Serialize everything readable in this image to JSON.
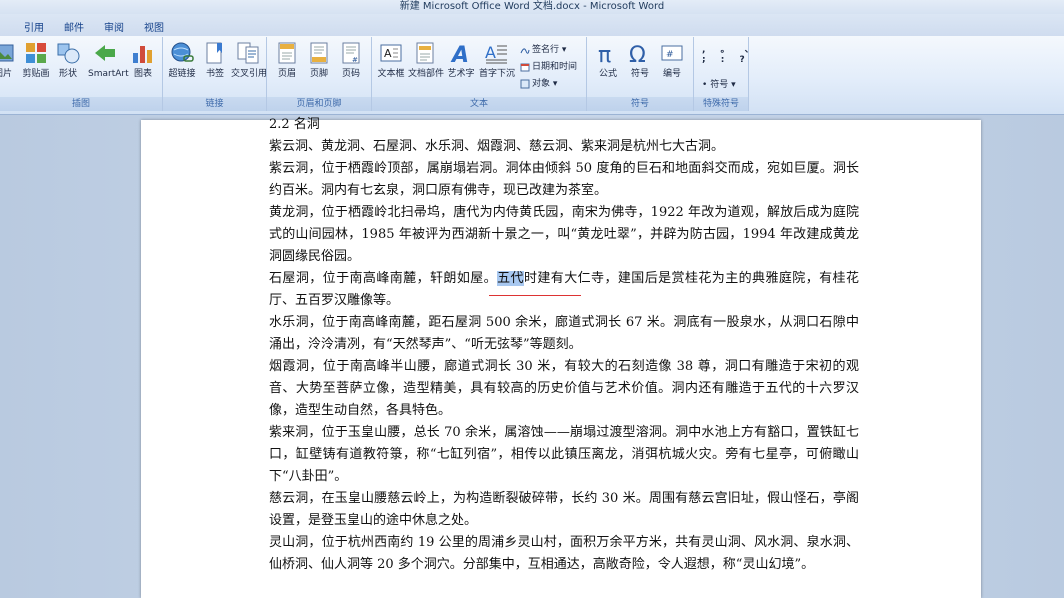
{
  "window": {
    "title": "新建 Microsoft Office Word 文档.docx - Microsoft Word"
  },
  "tabs": [
    {
      "label": "引用"
    },
    {
      "label": "邮件"
    },
    {
      "label": "审阅"
    },
    {
      "label": "视图"
    }
  ],
  "ribbon": {
    "groups": [
      {
        "label": "插图",
        "buttons": [
          "图片",
          "剪贴画",
          "形状",
          "SmartArt",
          "图表"
        ]
      },
      {
        "label": "链接",
        "buttons": [
          "超链接",
          "书签",
          "交叉引用"
        ]
      },
      {
        "label": "页眉和页脚",
        "buttons": [
          "页眉",
          "页脚",
          "页码"
        ]
      },
      {
        "label": "文本",
        "buttons": [
          "文本框",
          "文档部件",
          "艺术字",
          "首字下沉"
        ],
        "small": [
          "签名行",
          "日期和时间",
          "对象"
        ]
      },
      {
        "label": "符号",
        "buttons": [
          "公式",
          "符号",
          "编号"
        ]
      },
      {
        "label": "特殊符号",
        "small": [
          "符号"
        ]
      }
    ]
  },
  "document": {
    "heading": "2.2 名洞",
    "paragraphs": [
      "紫云洞、黄龙洞、石屋洞、水乐洞、烟霞洞、慈云洞、紫来洞是杭州七大古洞。",
      "紫云洞，位于栖霞岭顶部，属崩塌岩洞。洞体由倾斜 50 度角的巨石和地面斜交而成，宛如巨厦。洞长约百米。洞内有七玄泉，洞口原有佛寺，现已改建为茶室。",
      "黄龙洞，位于栖霞岭北扫帚坞，唐代为内侍黄氏园，南宋为佛寺，1922 年改为道观，解放后成为庭院式的山间园林，1985 年被评为西湖新十景之一，叫“黄龙吐翠”，并辟为防古园，1994 年改建成黄龙洞圆缘民俗园。",
      "石屋洞，位于南高峰南麓，轩朗如屋。",
      "五代",
      "时建有大仁寺，建国后是赏桂花为主的典雅庭院，有桂花厅、五百罗汉雕像等。",
      "水乐洞，位于南高峰南麓，距石屋洞 500 余米，廊道式洞长 67 米。洞底有一股泉水，从洞口石隙中涌出，泠泠清冽，有“天然琴声”、“听无弦琴”等题刻。",
      "烟霞洞，位于南高峰半山腰，廊道式洞长 30 米，有较大的石刻造像 38 尊，洞口有雕造于宋初的观音、大势至菩萨立像，造型精美，具有较高的历史价值与艺术价值。洞内还有雕造于五代的十六罗汉像，造型生动自然，各具特色。",
      "紫来洞，位于玉皇山腰，总长 70 余米，属溶蚀——崩塌过渡型溶洞。洞中水池上方有豁口，置铁缸七口，缸壁铸有道教符箓，称“七缸列宿”，相传以此镇压离龙，消弭杭城火灾。旁有七星亭，可俯瞰山下“八卦田”。",
      "慈云洞，在玉皇山腰慈云岭上，为构造断裂破碎带，长约 30 米。周围有慈云宫旧址，假山怪石，亭阁设置，是登玉皇山的途中休息之处。",
      "灵山洞，位于杭州西南约 19 公里的周浦乡灵山村，面积万余平方米，共有灵山洞、风水洞、泉水洞、仙桥洞、仙人洞等 20 多个洞穴。分部集中，互相通达，高敞奇险，令人遐想，称“灵山幻境”。"
    ]
  }
}
